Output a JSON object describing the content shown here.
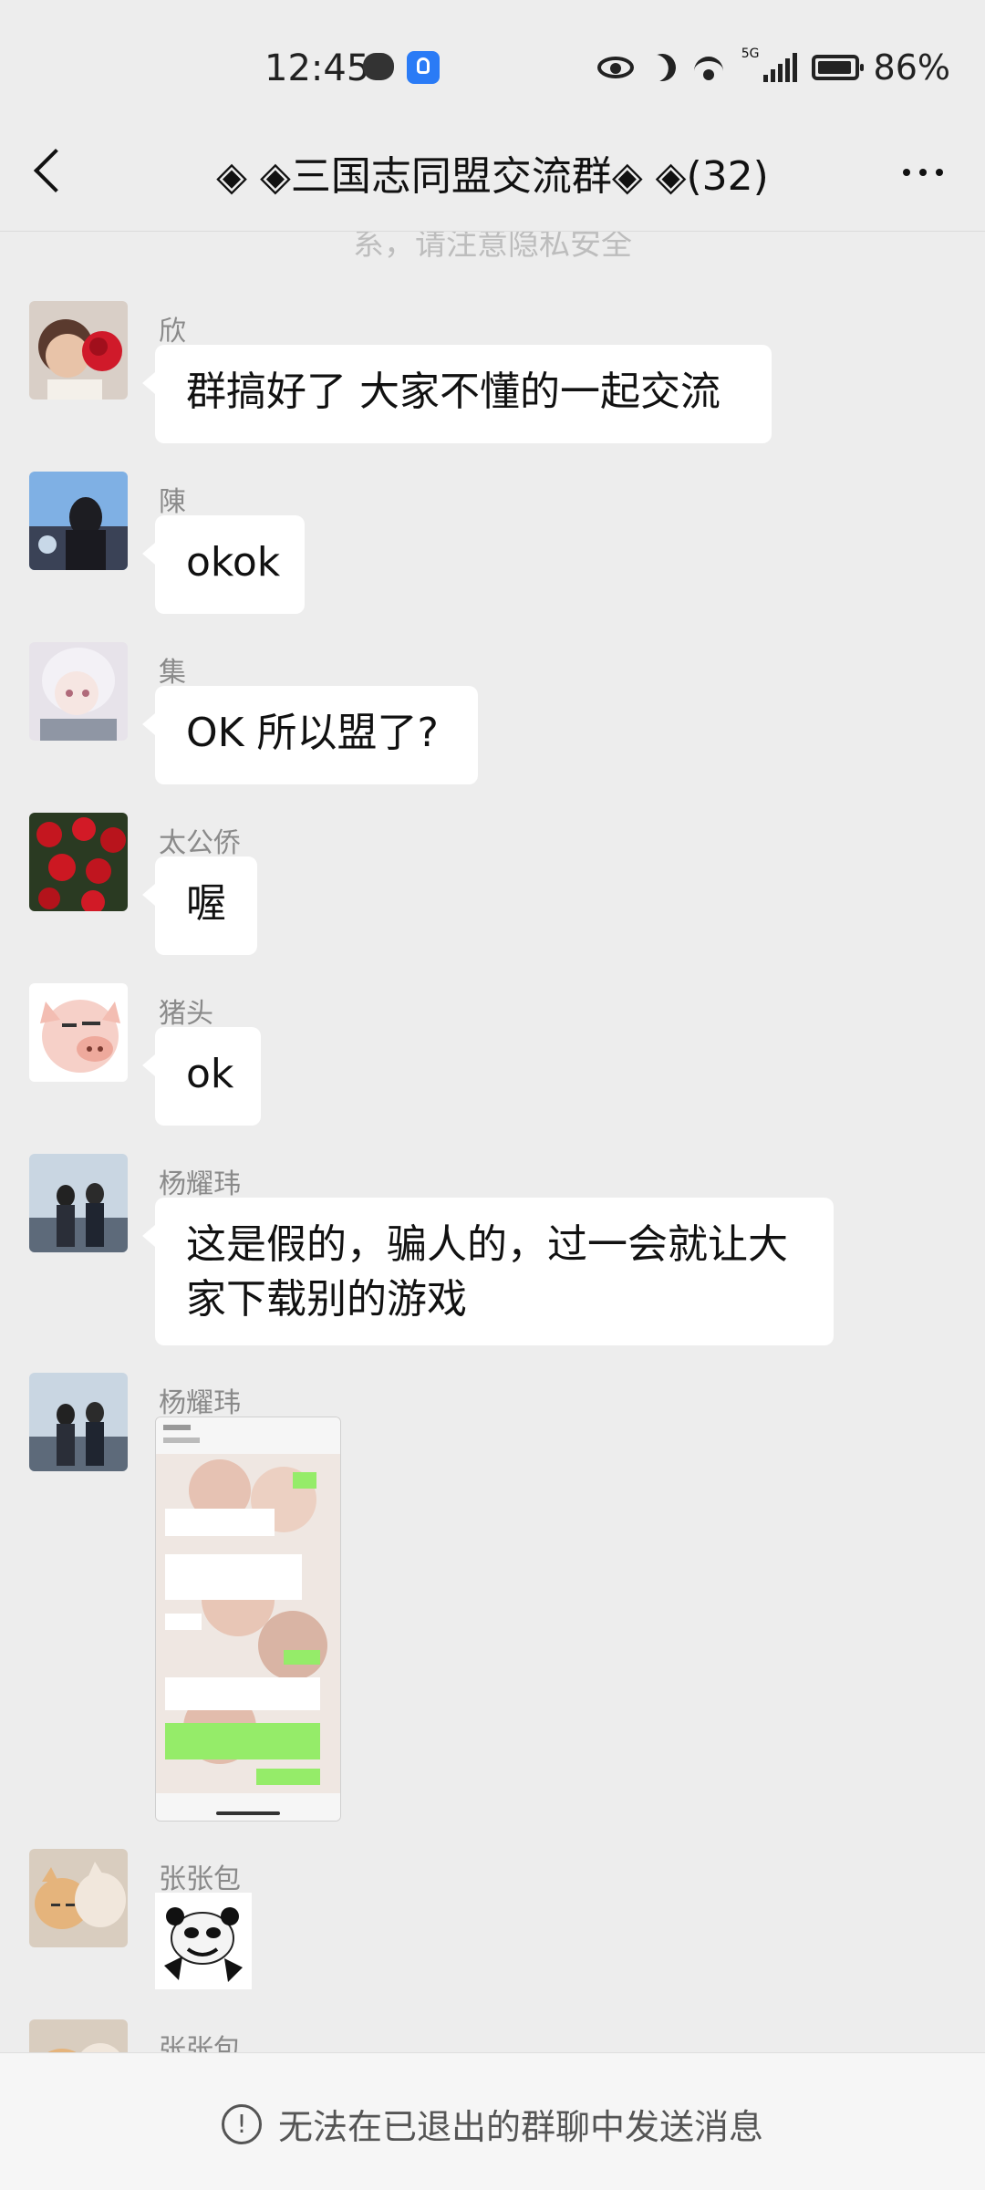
{
  "status_bar": {
    "time": "12:45",
    "battery": "86%",
    "network": "5G"
  },
  "header": {
    "title": "◈ ◈三国志同盟交流群◈ ◈(32)"
  },
  "notice": "系，请注意隐私安全",
  "messages": [
    {
      "sender": "欣",
      "text": "群搞好了 大家不懂的一起交流"
    },
    {
      "sender": "陳",
      "text": "okok"
    },
    {
      "sender": "集",
      "text": "OK 所以盟了?"
    },
    {
      "sender": "太公侨",
      "text": "喔"
    },
    {
      "sender": "猪头",
      "text": "ok"
    },
    {
      "sender": "杨耀玮",
      "text": "这是假的，骗人的，过一会就让大家下载别的游戏"
    },
    {
      "sender": "杨耀玮",
      "type": "image"
    },
    {
      "sender": "张张包",
      "type": "sticker"
    },
    {
      "sender": "张张包"
    }
  ],
  "footer": {
    "text": "无法在已退出的群聊中发送消息",
    "icon": "info-circle-icon"
  },
  "colors": {
    "background": "#ededed",
    "bubble": "#ffffff",
    "sender_name": "#8a8a8a"
  }
}
